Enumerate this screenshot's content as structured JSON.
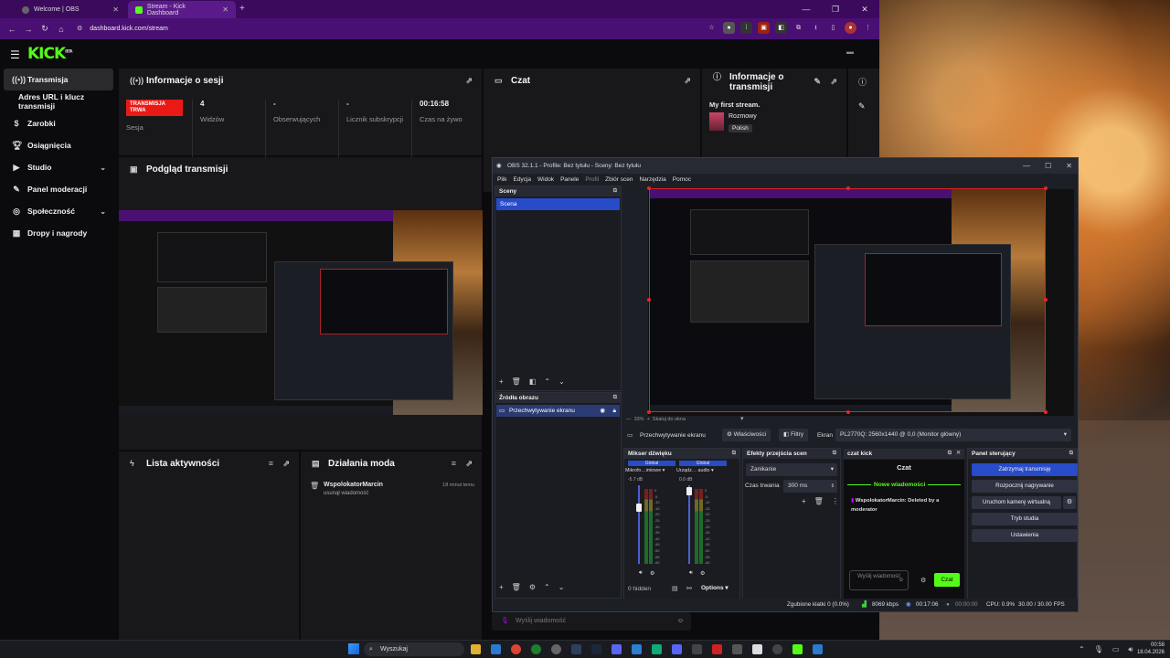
{
  "browser": {
    "tabs": [
      {
        "title": "Welcome | OBS",
        "active": false
      },
      {
        "title": "Stream - Kick Dashboard",
        "active": true
      }
    ],
    "url": "dashboard.kick.com/stream",
    "new_tab": "+",
    "window_controls": [
      "—",
      "❐",
      "✕"
    ]
  },
  "kick": {
    "logo": "KICK",
    "logo_sup": "BETA",
    "sidebar": [
      {
        "label": "Transmisja",
        "icon": "broadcast-icon",
        "active": true
      },
      {
        "label": "Adres URL i klucz transmisji",
        "sub": true
      },
      {
        "label": "Zarobki",
        "icon": "dollar-icon"
      },
      {
        "label": "Osiągnięcia",
        "icon": "trophy-icon"
      },
      {
        "label": "Studio",
        "icon": "video-icon",
        "chevron": true
      },
      {
        "label": "Panel moderacji",
        "icon": "wrench-icon"
      },
      {
        "label": "Społeczność",
        "icon": "globe-icon",
        "chevron": true
      },
      {
        "label": "Dropy i nagrody",
        "icon": "gift-icon"
      }
    ],
    "session": {
      "title": "Informacje o sesji",
      "stats": [
        {
          "value": "TRANSMISJA TRWA",
          "label": "Sesja",
          "badge": true
        },
        {
          "value": "4",
          "label": "Widzów"
        },
        {
          "value": "-",
          "label": "Obserwujących"
        },
        {
          "value": "-",
          "label": "Licznik subskrypcji"
        },
        {
          "value": "00:16:58",
          "label": "Czas na żywo"
        }
      ]
    },
    "preview": {
      "title": "Podgląd transmisji"
    },
    "chat": {
      "title": "Czat",
      "input_placeholder": "Wyślij wiadomość"
    },
    "stream_info": {
      "title": "Informacje o transmisji",
      "stream_title": "My first stream.",
      "category": "Rozmowy",
      "language": "Polish"
    },
    "activity": {
      "title": "Lista aktywności"
    },
    "mod_actions": {
      "title": "Działania moda",
      "items": [
        {
          "user": "WspolokatorMarcin",
          "action": "usunął wiadomość",
          "time": "18 minut temu"
        }
      ]
    }
  },
  "obs": {
    "title": "OBS 32.1.1 - Profile: Bez tytułu - Sceny: Bez tytułu",
    "menu": [
      "Plik",
      "Edycja",
      "Widok",
      "Panele",
      "Profil",
      "Zbiór scen",
      "Narzędzia",
      "Pomoc"
    ],
    "scenes": {
      "title": "Sceny",
      "items": [
        "Scena"
      ]
    },
    "sources": {
      "title": "Źródła obrazu",
      "items": [
        "Przechwytywanie ekranu"
      ]
    },
    "zoom": "33%",
    "scale_label": "Skaluj do okna",
    "source_bar": {
      "name": "Przechwytywanie ekranu",
      "properties": "Właściwości",
      "filters": "Filtry",
      "screen_label": "Ekran",
      "screen_value": "PL2770Q: 2560x1440 @ 0,0 (Monitor główny)"
    },
    "mixer": {
      "title": "Mikser dźwięku",
      "channels": [
        {
          "tag": "Global",
          "name": "Mikrofo…imiowe",
          "db": "-5.7 dB"
        },
        {
          "tag": "Global",
          "name": "Urządz… audio",
          "db": "0.0 dB"
        }
      ],
      "scale": [
        "0",
        "-5",
        "-10",
        "-15",
        "-20",
        "-25",
        "-30",
        "-35",
        "-40",
        "-45",
        "-50",
        "-55",
        "-60"
      ],
      "hidden": "0 hidden",
      "options": "Options"
    },
    "transitions": {
      "title": "Efekty przejścia scen",
      "type": "Zanikanie",
      "duration_label": "Czas trwania",
      "duration_value": "300 ms"
    },
    "chat_dock": {
      "title": "czat kick",
      "header": "Czat",
      "divider": "Nowe wiadomości",
      "message_user": "WspolokatorMarcin:",
      "message_text": "Deleted by a moderator",
      "input_placeholder": "Wyślij wiadomość",
      "send": "Czat"
    },
    "controls": {
      "title": "Panel sterujący",
      "buttons": [
        "Zatrzymaj transmisję",
        "Rozpocznij nagrywanie",
        "Uruchom kamerę wirtualną",
        "Tryb studia",
        "Ustawienia"
      ]
    },
    "status": {
      "dropped": "Zgubione klatki 0 (0.0%)",
      "bitrate": "8069 kbps",
      "stream_time": "00:17:06",
      "rec_time": "00:00:00",
      "cpu": "CPU: 0.9%",
      "fps": "30.00 / 30.00 FPS"
    }
  },
  "taskbar": {
    "search": "Wyszukaj",
    "time": "00:58",
    "date": "18.04.2026"
  },
  "colors": {
    "kick_green": "#53fc18",
    "live_red": "#e91916",
    "obs_blue": "#284bc9",
    "browser_purple": "#4a0f72"
  }
}
